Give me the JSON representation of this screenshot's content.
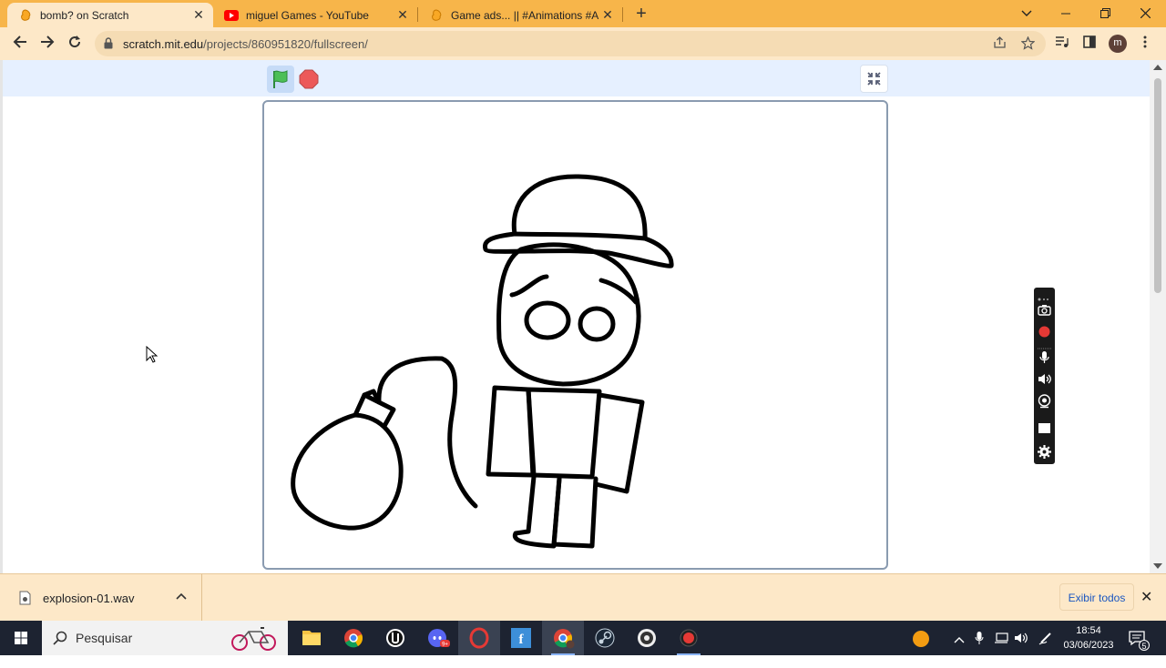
{
  "browser": {
    "tabs": [
      {
        "title": "bomb? on Scratch",
        "favicon": "scratch-icon",
        "active": true
      },
      {
        "title": "miguel Games - YouTube",
        "favicon": "youtube-icon",
        "active": false
      },
      {
        "title": "Game ads... || #Animations #All #",
        "favicon": "scratch-icon",
        "active": false
      }
    ],
    "new_tab": "+",
    "url_domain": "scratch.mit.edu",
    "url_path": "/projects/860951820/fullscreen/",
    "profile_initial": "m",
    "window_controls": {
      "dropdown": "⌄",
      "minimize": "—",
      "restore": "❐",
      "close": "✕"
    },
    "tab_close": "✕",
    "colors": {
      "frame": "#f7b54a",
      "toolbar": "#fde8c8"
    }
  },
  "scratch": {
    "controls": [
      "green-flag-icon",
      "stop-icon"
    ],
    "unfullscreen": "unfullscreen-icon",
    "colors": {
      "menu_bg": "#e6f0ff",
      "flag": "#4cbf56",
      "stop": "#ec5959"
    }
  },
  "download": {
    "filename": "explosion-01.wav",
    "show_all": "Exibir todos",
    "close": "✕"
  },
  "taskbar": {
    "search_placeholder": "Pesquisar",
    "time": "18:54",
    "date": "03/06/2023",
    "notification_count": "5",
    "apps": [
      "file-explorer-icon",
      "chrome-icon",
      "unreal-icon",
      "discord-icon",
      "opera-icon",
      "flash-icon",
      "chrome-profile-icon",
      "steam-icon",
      "obs-icon",
      "record-icon"
    ]
  }
}
